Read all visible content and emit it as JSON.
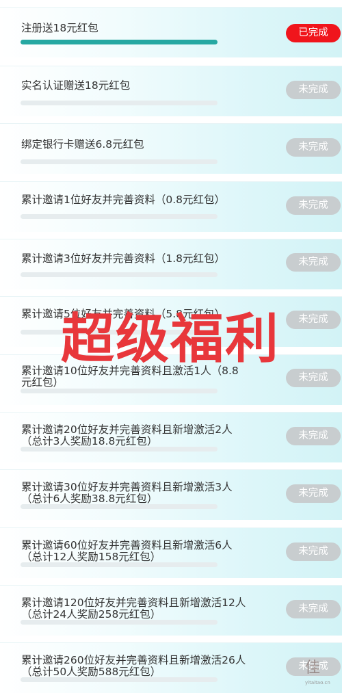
{
  "tasks": [
    {
      "title": "注册送18元红包",
      "status": "已完成",
      "done": true,
      "progress": 1
    },
    {
      "title": "实名认证赠送18元红包",
      "status": "未完成",
      "done": false,
      "progress": 0
    },
    {
      "title": "绑定银行卡赠送6.8元红包",
      "status": "未完成",
      "done": false,
      "progress": 0
    },
    {
      "title": "累计邀请1位好友并完善资料（0.8元红包）",
      "status": "未完成",
      "done": false,
      "progress": 0
    },
    {
      "title": "累计邀请3位好友并完善资料（1.8元红包）",
      "status": "未完成",
      "done": false,
      "progress": 0
    },
    {
      "title": "累计邀请5位好友并完善资料（5.8元红包）",
      "status": "未完成",
      "done": false,
      "progress": 0
    },
    {
      "title": "累计邀请10位好友并完善资料且激活1人（8.8元红包）",
      "status": "未完成",
      "done": false,
      "progress": 0
    },
    {
      "title": "累计邀请20位好友并完善资料且新增激活2人（总计3人奖励18.8元红包）",
      "status": "未完成",
      "done": false,
      "progress": 0
    },
    {
      "title": "累计邀请30位好友并完善资料且新增激活3人（总计6人奖励38.8元红包）",
      "status": "未完成",
      "done": false,
      "progress": 0
    },
    {
      "title": "累计邀请60位好友并完善资料且新增激活6人（总计12人奖励158元红包）",
      "status": "未完成",
      "done": false,
      "progress": 0
    },
    {
      "title": "累计邀请120位好友并完善资料且新增激活12人（总计24人奖励258元红包）",
      "status": "未完成",
      "done": false,
      "progress": 0
    },
    {
      "title": "累计邀请260位好友并完善资料且新增激活26人（总计50人奖励588元红包）",
      "status": "未完成",
      "done": false,
      "progress": 0
    }
  ],
  "overlay_text": "超级福利",
  "watermark_seal": "佳",
  "watermark_text": "yitaitao.cn",
  "colors": {
    "done_badge": "#f0151c",
    "pending_badge": "#c8cdcf",
    "progress_fill": "#26a8a2",
    "overlay": "#e8373b"
  }
}
